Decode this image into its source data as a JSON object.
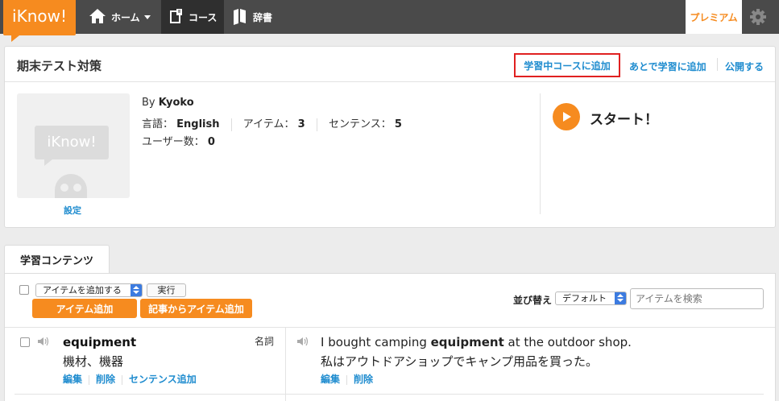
{
  "nav": {
    "logo": "iKnow!",
    "home": "ホーム",
    "course": "コース",
    "dictionary": "辞書",
    "premium": "プレミアム"
  },
  "course": {
    "title": "期末テスト対策",
    "add_to_studying": "学習中コースに追加",
    "add_later": "あとで学習に追加",
    "publish": "公開する",
    "thumb_logo": "iKnow!",
    "settings": "設定",
    "by_label": "By",
    "author": "Kyoko",
    "lang_label": "言語：",
    "lang_value": "English",
    "items_label": "アイテム：",
    "items_value": "3",
    "sentences_label": "センテンス：",
    "sentences_value": "5",
    "users_label": "ユーザー数：",
    "users_value": "0",
    "start": "スタート！"
  },
  "contents": {
    "tab": "学習コンテンツ",
    "item_select": "アイテムを追加する",
    "execute": "実行",
    "add_item": "アイテム追加",
    "add_from_article": "記事からアイテム追加",
    "sort_label": "並び替え",
    "sort_value": "デフォルト",
    "search_placeholder": "アイテムを検索"
  },
  "items": [
    {
      "word": "equipment",
      "pos": "名詞",
      "meaning": "機材、機器",
      "edit": "編集",
      "delete": "削除",
      "add_sentence": "センテンス追加",
      "sentence_before": "I bought camping ",
      "sentence_bold": "equipment",
      "sentence_after": " at the outdoor shop.",
      "sentence_ja": "私はアウトドアショップでキャンプ用品を買った。",
      "s_edit": "編集",
      "s_delete": "削除"
    }
  ]
}
